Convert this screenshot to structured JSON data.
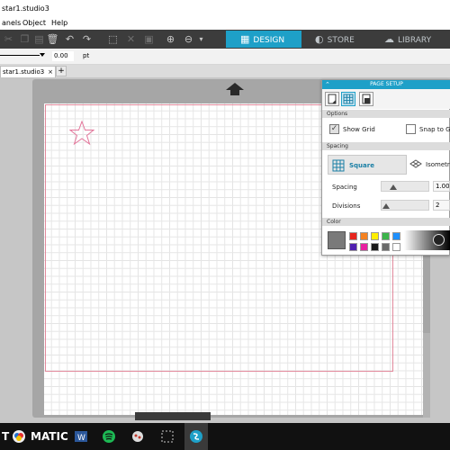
{
  "window": {
    "title": "star1.studio3"
  },
  "menu": {
    "items": [
      "anels",
      "Object",
      "Help"
    ]
  },
  "toolbar": {
    "tabs": [
      {
        "label": "DESIGN",
        "active": true
      },
      {
        "label": "STORE",
        "active": false
      },
      {
        "label": "LIBRARY",
        "active": false
      }
    ]
  },
  "options": {
    "line_width": "0.00",
    "unit": "pt"
  },
  "doc_tabs": {
    "active": "star1.studio3",
    "close": "×",
    "add": "+"
  },
  "page_setup": {
    "title": "PAGE SETUP",
    "sections": {
      "options": "Options",
      "spacing": "Spacing",
      "color": "Color"
    },
    "show_grid": {
      "label": "Show Grid",
      "checked": true
    },
    "snap_to_grid": {
      "label": "Snap to G",
      "checked": false
    },
    "grid_types": [
      {
        "label": "Square",
        "selected": true
      },
      {
        "label": "Isometr",
        "selected": false
      }
    ],
    "spacing": {
      "label": "Spacing",
      "value": "1.000"
    },
    "divisions": {
      "label": "Divisions",
      "value": "2"
    },
    "color_swatches": [
      "#e8251e",
      "#f58220",
      "#ffef00",
      "#3bb44a",
      "#1e90ff",
      "#5020b0",
      "#e820a0",
      "#1a1a1a",
      "#6a6a6a",
      "#ffffff"
    ]
  },
  "taskbar": {
    "start_text": "T",
    "app_text": "MATIC"
  }
}
